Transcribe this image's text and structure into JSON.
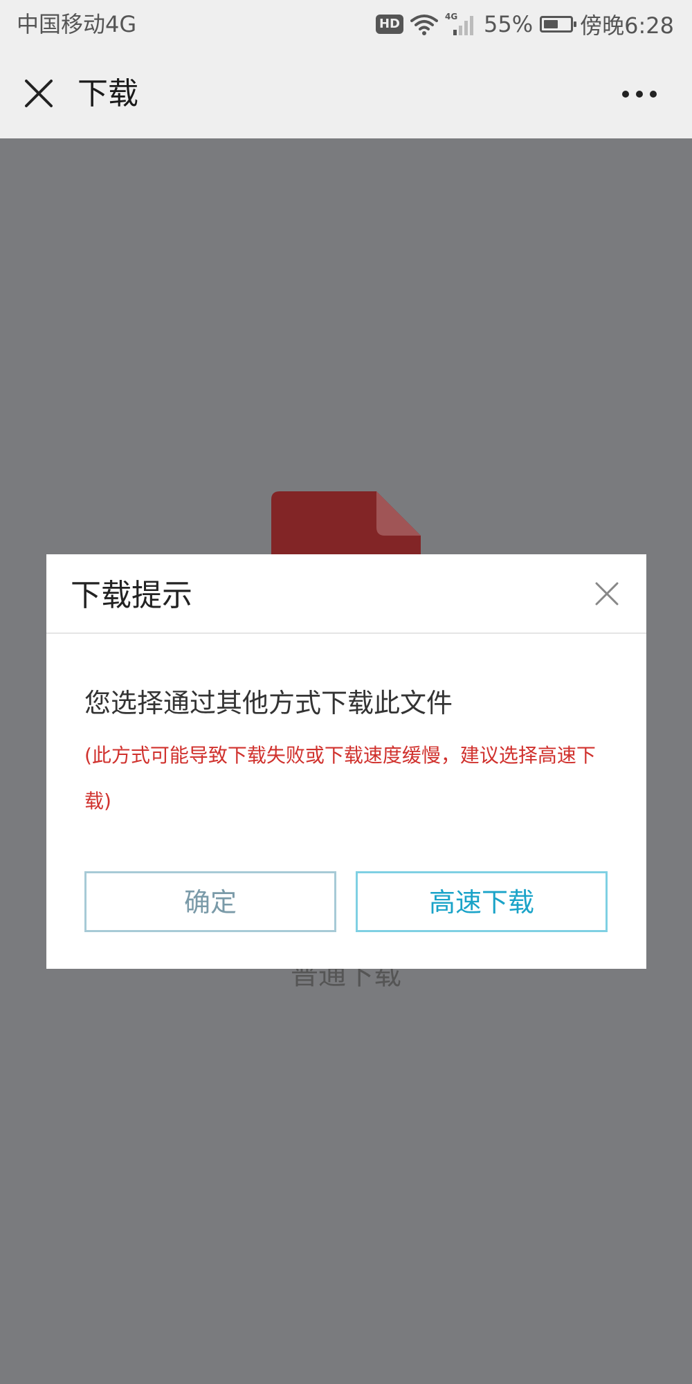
{
  "status_bar": {
    "carrier": "中国移动4G",
    "hd_badge": "HD",
    "network": "4G",
    "battery_percent": "55%",
    "battery_level": 0.55,
    "time": "傍晚6:28"
  },
  "nav": {
    "close_icon": "close-icon",
    "title": "下载",
    "more_icon": "more-icon"
  },
  "background": {
    "file_icon": "file-icon",
    "file_icon_color": "#8b2a2a",
    "normal_download_label": "普通下载"
  },
  "dialog": {
    "title": "下载提示",
    "close_icon": "close-icon",
    "message": "您选择通过其他方式下载此文件",
    "warning": "(此方式可能导致下载失败或下载速度缓慢，建议选择高速下载)",
    "warning_color": "#d0312d",
    "confirm_label": "确定",
    "fast_download_label": "高速下载",
    "accent_color": "#1aa3c8"
  }
}
